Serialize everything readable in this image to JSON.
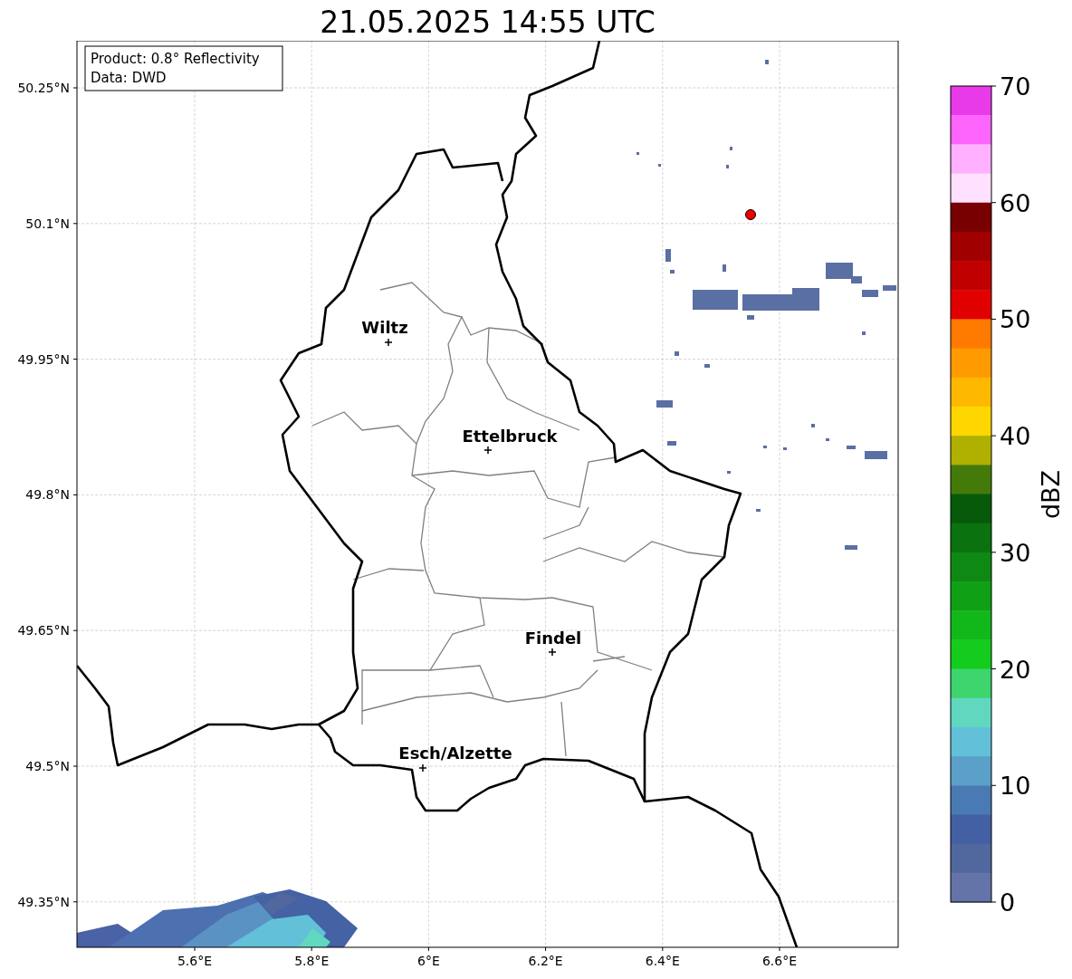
{
  "title": "21.05.2025 14:55 UTC",
  "info_box": {
    "lines": [
      "Product: 0.8° Reflectivity",
      "Data: DWD"
    ]
  },
  "map": {
    "y_ticks": [
      "50.25°N",
      "50.1°N",
      "49.95°N",
      "49.8°N",
      "49.65°N",
      "49.5°N",
      "49.35°N"
    ],
    "x_ticks": [
      "5.6°E",
      "5.8°E",
      "6°E",
      "6.2°E",
      "6.4°E",
      "6.6°E"
    ],
    "cities": [
      {
        "name": "Wiltz"
      },
      {
        "name": "Ettelbruck"
      },
      {
        "name": "Findel"
      },
      {
        "name": "Esch/Alzette"
      }
    ]
  },
  "colorbar": {
    "label": "dBZ",
    "ticks": [
      "70",
      "60",
      "50",
      "40",
      "30",
      "20",
      "10",
      "0"
    ],
    "bins": [
      {
        "color": "#e83ae8"
      },
      {
        "color": "#fd65fd"
      },
      {
        "color": "#ffb0ff"
      },
      {
        "color": "#ffe0ff"
      },
      {
        "color": "#780000"
      },
      {
        "color": "#a00000"
      },
      {
        "color": "#c00000"
      },
      {
        "color": "#e00000"
      },
      {
        "color": "#ff7a00"
      },
      {
        "color": "#ff9a00"
      },
      {
        "color": "#ffb800"
      },
      {
        "color": "#ffd700"
      },
      {
        "color": "#b0b000"
      },
      {
        "color": "#447a0a"
      },
      {
        "color": "#065a0a"
      },
      {
        "color": "#0a720f"
      },
      {
        "color": "#0e8a14"
      },
      {
        "color": "#10a016"
      },
      {
        "color": "#12b81a"
      },
      {
        "color": "#14cc1e"
      },
      {
        "color": "#3ed46e"
      },
      {
        "color": "#60d8c0"
      },
      {
        "color": "#62c0d8"
      },
      {
        "color": "#5aa0c8"
      },
      {
        "color": "#4a7ab4"
      },
      {
        "color": "#4460a4"
      },
      {
        "color": "#50689e"
      },
      {
        "color": "#6474a8"
      }
    ]
  }
}
